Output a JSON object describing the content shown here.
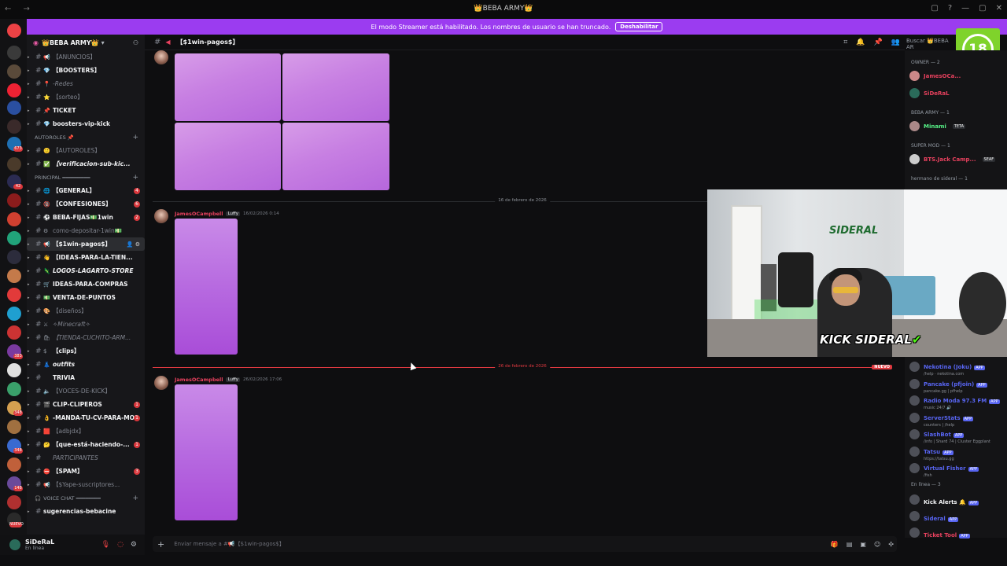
{
  "window": {
    "title": "👑BEBA ARMY👑",
    "controls": [
      "▢",
      "?",
      "—",
      "▢",
      "✕"
    ]
  },
  "banner": {
    "text": "El modo Streamer está habilitado. Los nombres de usuario se han truncado.",
    "button": "Deshabilitar"
  },
  "server": {
    "name": "👑BEBA ARMY👑"
  },
  "server_badges": [
    "673",
    "42",
    "1",
    "3",
    "383",
    "348",
    "348",
    "148",
    "NUEVO"
  ],
  "channels": [
    {
      "label": "【ANUNCIOS】",
      "emoji": "📢",
      "style": "bold-dim"
    },
    {
      "label": "【BOOSTERS】",
      "emoji": "💎",
      "style": "bold"
    },
    {
      "label": "-Redes",
      "emoji": "📍",
      "style": "dim-ital"
    },
    {
      "label": "【sorteo】",
      "emoji": "⭐",
      "style": "dim"
    },
    {
      "label": "TICKET",
      "emoji": "📌",
      "style": "bold"
    },
    {
      "label": "boosters-vip-kick",
      "emoji": "💎",
      "style": "bold-plain"
    }
  ],
  "cat_autoroles": "AUTOROLES 📌",
  "channels_autoroles": [
    {
      "label": "【AUTOROLES】",
      "emoji": "🙂",
      "style": "dim"
    },
    {
      "label": "【verificacion-sub-kic...",
      "emoji": "✅",
      "style": "bold-ital"
    }
  ],
  "cat_principal": "PRINCIPAL ━━━━━━━━━",
  "channels_principal": [
    {
      "label": "【GENERAL】",
      "emoji": "🌐",
      "mention": "4"
    },
    {
      "label": "【CONFESIONES】",
      "emoji": "🔞",
      "mention": "6"
    },
    {
      "label": "BEBA-FIJAS💵1win",
      "emoji": "⚽",
      "mention": "2"
    },
    {
      "label": "como-depositar-1win💵",
      "emoji": "⚙",
      "dim": true
    },
    {
      "label": "【$1win-pagos$】",
      "emoji": "📢",
      "active": true
    },
    {
      "label": "【IDEAS-PARA-LA-TIEN...",
      "emoji": "👋"
    },
    {
      "label": "LOGOS-LAGARTO-STORE",
      "emoji": "🦎",
      "ital": true
    },
    {
      "label": "IDEAS-PARA-COMPRAS",
      "emoji": "🛒"
    },
    {
      "label": "VENTA-DE-PUNTOS",
      "emoji": "💵"
    },
    {
      "label": "【diseños】",
      "emoji": "🎨",
      "dim": true
    },
    {
      "label": "✧Minecraft✧",
      "emoji": "⚔",
      "dim": true,
      "ital": true
    },
    {
      "label": "【TIENDA-CUCHITO-ARM...",
      "emoji": "🛍",
      "dim": true,
      "ital": true
    },
    {
      "label": "【clips】",
      "emoji": "$"
    },
    {
      "label": "outfits",
      "emoji": "👗",
      "ital": true
    },
    {
      "label": "TRIVIA",
      "emoji": ""
    },
    {
      "label": "【VOCES-DE-KICK】",
      "emoji": "🔈",
      "dim": true
    },
    {
      "label": "CLIP-CLIPEROS",
      "emoji": "🎬",
      "mention": "1"
    },
    {
      "label": "-MANDA-TU-CV-PARA-MOD",
      "emoji": "👌",
      "mention": "1"
    },
    {
      "label": "【adbjdx】",
      "emoji": "🟥",
      "dim": true
    },
    {
      "label": "【que-está-haciendo-...",
      "emoji": "🤔",
      "mention": "1"
    },
    {
      "label": "PARTICIPANTES",
      "emoji": "",
      "dim": true,
      "ital": true
    },
    {
      "label": "【SPAM】",
      "emoji": "⛔",
      "mention": "3"
    },
    {
      "label": "【$Yape-suscriptores...",
      "emoji": "📢",
      "dim": true
    }
  ],
  "cat_voice": "VOICE CHAT ━━━━━━━━",
  "voice_channel": "sugerencias-bebacine",
  "user": {
    "name": "SiDeRaL",
    "status": "En línea"
  },
  "chat": {
    "channel": "【$1win-pagos$】",
    "search_placeholder": "Buscar 👑BEBA AR",
    "age_rating": "18",
    "date_divider_1": "16 de febrero de 2026",
    "date_divider_2": "26 de febrero de 2026",
    "new_label": "NUEVO",
    "messages": [
      {
        "author": "JamesOCampbell",
        "role": "Luffy",
        "time": "16/02/2026 0:14"
      },
      {
        "author": "JamesOCampbell",
        "role": "Luffy",
        "time": "26/02/2026 17:06"
      }
    ],
    "composer_placeholder": "Enviar mensaje a #📢【$1win-pagos$】"
  },
  "members": {
    "owner_group": "OWNER — 2",
    "owner_members": [
      "JamesOCa...",
      "SiDeRaL"
    ],
    "beba_group": "BEBA ARMY — 1",
    "beba_members": [
      {
        "name": "Minami",
        "tag": "TETA"
      }
    ],
    "mod_group": "SUPER MOD — 1",
    "mod_members": [
      {
        "name": "BTS.Jack Camp...",
        "tag": "SEAF"
      }
    ],
    "hermano_group": "hermano de sideral — 1",
    "bots": [
      {
        "name": "Nekotina (Joku)",
        "sub": "/help · nekotina.com",
        "color": "#5865f2"
      },
      {
        "name": "Pancake (pfjoin)",
        "sub": "pancake.gg | pfhelp",
        "color": "#5865f2"
      },
      {
        "name": "Radio Moda 97.3 FM",
        "sub": "music 24/7 🔊",
        "color": "#5865f2"
      },
      {
        "name": "ServerStats",
        "sub": "counters | /help",
        "color": "#5865f2"
      },
      {
        "name": "SlashBot",
        "sub": "/info | Shard 74 | Cluster Eggplant",
        "color": "#5865f2"
      },
      {
        "name": "Tatsu",
        "sub": "https://tatsu.gg",
        "color": "#5865f2"
      },
      {
        "name": "Virtual Fisher",
        "sub": "/fish",
        "color": "#5865f2"
      }
    ],
    "online_group": "En línea — 3",
    "online": [
      {
        "name": "Kick Alerts 🔔",
        "color": "#f2f3f5"
      },
      {
        "name": "Sideral",
        "color": "#5865f2"
      },
      {
        "name": "Ticket Tool",
        "color": "#e8415e"
      }
    ],
    "app_label": "APP"
  },
  "webcam": {
    "label": "KICK SIDERAL",
    "logo": "SIDERAL"
  },
  "colors": {
    "accent": "#9b3cf0",
    "mention": "#da373c",
    "author": "#e8415e",
    "age": "#7fd32b",
    "kick": "#53fc18"
  }
}
